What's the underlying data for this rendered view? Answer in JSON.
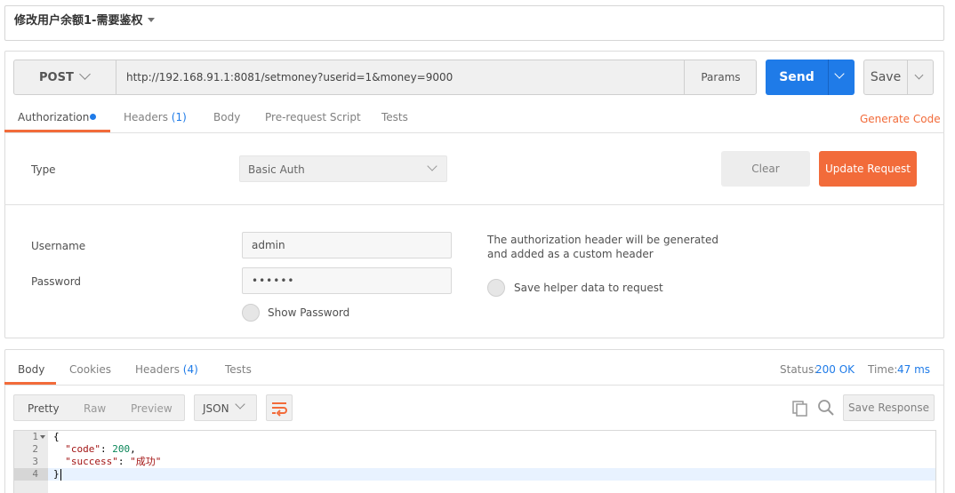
{
  "header": {
    "title": "修改用户余额1-需要鉴权"
  },
  "request": {
    "method": "POST",
    "url": "http://192.168.91.1:8081/setmoney?userid=1&money=9000",
    "params_label": "Params",
    "send_label": "Send",
    "save_label": "Save"
  },
  "request_tabs": {
    "authorization": "Authorization",
    "headers": "Headers",
    "headers_count": "(1)",
    "body": "Body",
    "prerequest": "Pre-request Script",
    "tests": "Tests",
    "generate_code": "Generate Code"
  },
  "auth": {
    "type_label": "Type",
    "type_value": "Basic Auth",
    "clear_label": "Clear",
    "update_label": "Update Request",
    "username_label": "Username",
    "username_value": "admin",
    "password_label": "Password",
    "password_value": "••••••",
    "show_password_label": "Show Password",
    "helper_note_line1": "The authorization header will be generated",
    "helper_note_line2": "and added as a custom header",
    "save_helper_label": "Save helper data to request"
  },
  "response_tabs": {
    "body": "Body",
    "cookies": "Cookies",
    "headers": "Headers",
    "headers_count": "(4)",
    "tests": "Tests"
  },
  "response_status": {
    "status_label": "Status:",
    "status_value": "200 OK",
    "time_label": "Time:",
    "time_value": "47 ms"
  },
  "response_toolbar": {
    "pretty": "Pretty",
    "raw": "Raw",
    "preview": "Preview",
    "format": "JSON",
    "save_response": "Save Response"
  },
  "response_body": {
    "line_numbers": [
      "1",
      "2",
      "3",
      "4"
    ],
    "code_key": "\"code\"",
    "code_value": "200",
    "success_key": "\"success\"",
    "success_value": "\"成功\""
  },
  "colors": {
    "accent_orange": "#f26b3a",
    "accent_blue": "#1f7be8"
  }
}
